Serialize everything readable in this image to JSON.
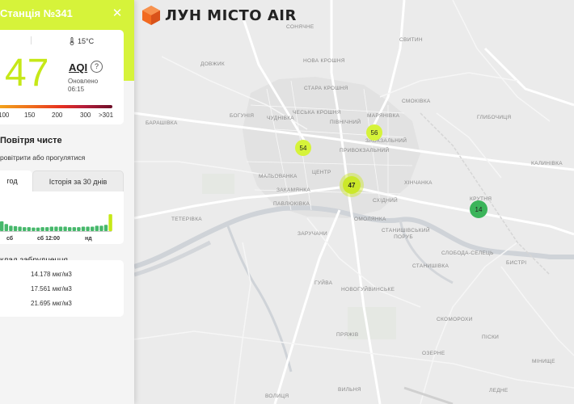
{
  "app": {
    "logo_text": "ЛУН МІСТО AIR",
    "colors": {
      "accent": "#d6f33a",
      "aqi_good": "#c6e817",
      "marker_green": "#3bb45a",
      "logo_orange": "#f26a21"
    }
  },
  "panel": {
    "title": "Станція №341",
    "close_icon": "close-icon",
    "temperature": "15°C",
    "aqi_value": "47",
    "aqi_label": "AQI",
    "help_label": "?",
    "updated_label": "Оновлено",
    "updated_time": "06:15",
    "scale_labels": [
      "100",
      "150",
      "200",
      "300",
      ">301"
    ],
    "status_title": "Повітря чисте",
    "status_text": "ровітрити або прогулятися",
    "tabs": [
      {
        "label": "год",
        "active": true
      },
      {
        "label": "Історія за 30 днів",
        "active": false
      }
    ],
    "chart": {
      "ticks": [
        "сб",
        "сб 12:00",
        "нд"
      ],
      "bars": [
        0.55,
        0.4,
        0.3,
        0.28,
        0.25,
        0.22,
        0.22,
        0.2,
        0.2,
        0.22,
        0.22,
        0.25,
        0.25,
        0.25,
        0.25,
        0.22,
        0.22,
        0.22,
        0.25,
        0.25,
        0.25,
        0.3,
        0.3,
        0.35,
        0.95
      ]
    },
    "pollution_title": "клад забруднення",
    "pollutants": [
      {
        "value": "14.178 мкг/м3"
      },
      {
        "value": "17.561 мкг/м3"
      },
      {
        "value": "21.695 мкг/м3"
      }
    ]
  },
  "map": {
    "markers": [
      {
        "value": "54",
        "color": "#d6f33a",
        "selected": false
      },
      {
        "value": "56",
        "color": "#d6f33a",
        "selected": false
      },
      {
        "value": "47",
        "color": "#cbe82a",
        "selected": true
      },
      {
        "value": "14",
        "color": "#3bb45a",
        "selected": false
      }
    ],
    "labels": [
      "СОНЯЧНЕ",
      "СВИТИН",
      "НОВА КРОШНЯ",
      "СТАРА КРОШНЯ",
      "ДОВЖИК",
      "СМОКІВКА",
      "ЧЕСЬКА КРОШНЯ",
      "ПІВНІЧНИЙ",
      "МАРЯНІВКА",
      "БОГУНІЯ",
      "ЧУДНІВКА",
      "ГЛИБОЧИЦЯ",
      "ЗАОКЗАЛЬНИЙ",
      "БАРАШІВКА",
      "ПРИВОКЗАЛЬНИЙ",
      "КАЛИНІВКА",
      "ЦЕНТР",
      "МАЛЬОВАНКА",
      "ЗАКАМЯНКА",
      "СХІДНИЙ",
      "ХІНЧАНКА",
      "КРУТНЯ",
      "ПАВЛЮКІВКА",
      "ТЕТЕРІВКА",
      "ОМОЛЯНКА",
      "СТАНИШІВСЬКИЙ ПОРУБ",
      "ЗАРУЧАНИ",
      "СЛОБОДА-СЕЛЕЦЬ",
      "БИСТРІ",
      "СТАНИШІВКА",
      "ГУЙВА",
      "НОВОГУЙВИНСЬКЕ",
      "СКОМОРОХИ",
      "ПРЯЖІВ",
      "ПІСКИ",
      "ОЗЕРНЕ",
      "МІНИЩЕ",
      "ВОЛИЦЯ",
      "ЛЕДНЕ",
      "ВИЛЬНЯ"
    ]
  }
}
